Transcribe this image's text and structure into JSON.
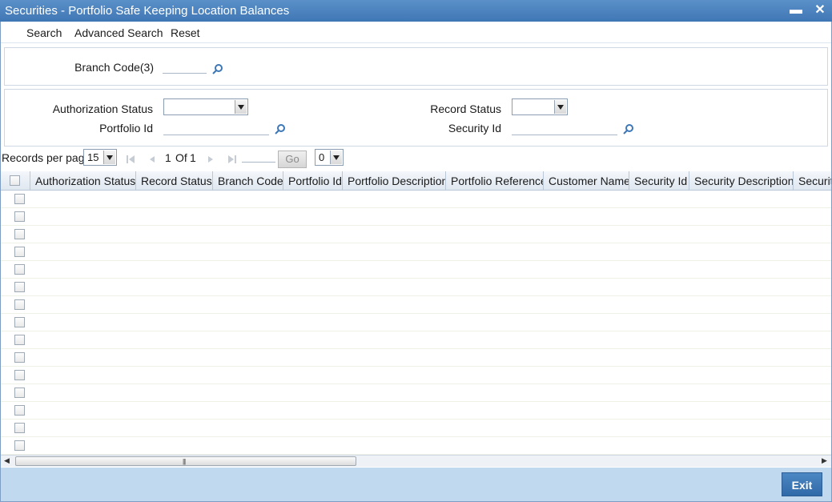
{
  "window": {
    "title": "Securities - Portfolio Safe Keeping Location Balances",
    "minimize_glyph": "▬",
    "close_glyph": "✕"
  },
  "menu": {
    "search": "Search",
    "advanced_search": "Advanced Search",
    "reset": "Reset"
  },
  "criteria": {
    "branch_code_label": "Branch Code(3)",
    "authorization_status_label": "Authorization Status",
    "authorization_status_value": "",
    "record_status_label": "Record Status",
    "record_status_value": "",
    "portfolio_id_label": "Portfolio Id",
    "security_id_label": "Security Id"
  },
  "pager": {
    "records_per_page_label": "Records per page",
    "records_per_page_value": "15",
    "current_page": "1",
    "of_label": "Of",
    "total_pages": "1",
    "go_label": "Go",
    "page_select_value": "0"
  },
  "grid": {
    "columns": [
      "Authorization Status",
      "Record Status",
      "Branch Code",
      "Portfolio Id",
      "Portfolio Description",
      "Portfolio Reference",
      "Customer Name",
      "Security Id",
      "Security Description",
      "Security"
    ]
  },
  "footer": {
    "exit_label": "Exit"
  },
  "colors": {
    "titlebar": "#3f77b5",
    "footer": "#c1d9ee",
    "exit_button": "#2f69a8"
  }
}
